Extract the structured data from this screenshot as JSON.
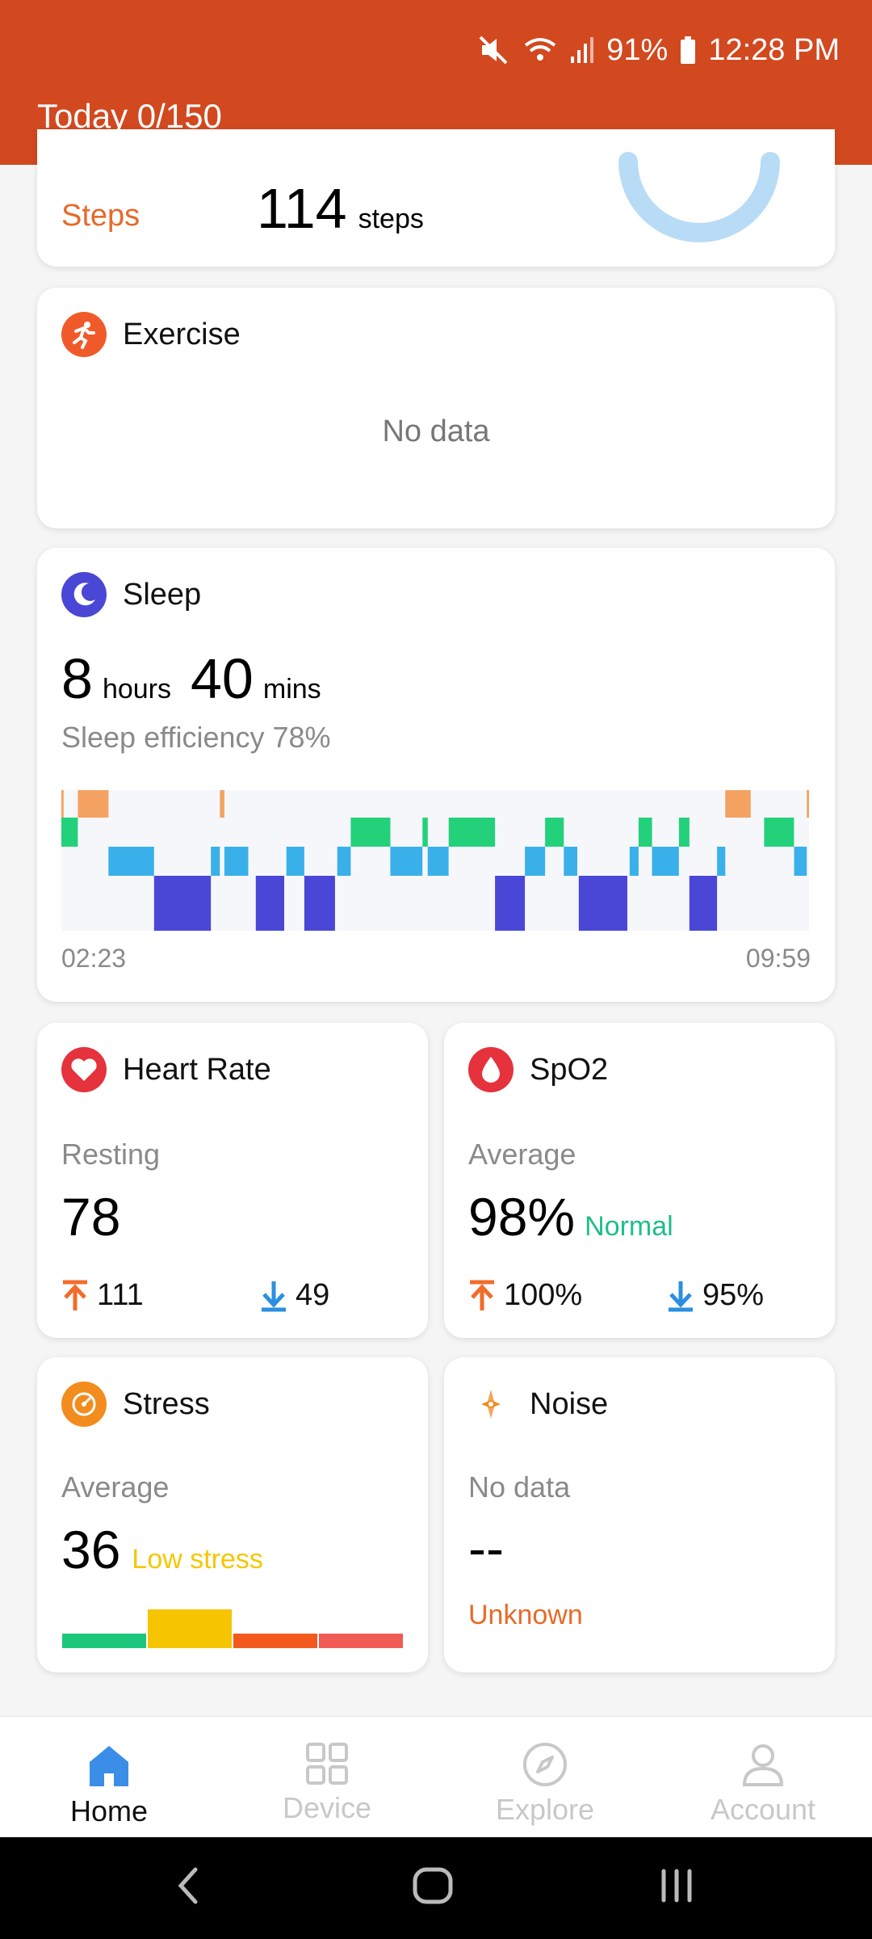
{
  "status_bar": {
    "battery": "91%",
    "time": "12:28 PM"
  },
  "header": {
    "title": "Today 0/150"
  },
  "steps": {
    "label": "Steps",
    "value": "114",
    "unit": "steps"
  },
  "exercise": {
    "title": "Exercise",
    "empty": "No data"
  },
  "sleep": {
    "title": "Sleep",
    "hours": "8",
    "hours_unit": "hours",
    "mins": "40",
    "mins_unit": "mins",
    "efficiency": "Sleep efficiency 78%",
    "start_time": "02:23",
    "end_time": "09:59",
    "stage_colors": {
      "awake": "#f4a261",
      "rem": "#23d17a",
      "light": "#3ab0ea",
      "deep": "#4a47d6"
    },
    "segments": [
      {
        "stage": "awake",
        "start": 0,
        "end": 0.003
      },
      {
        "stage": "awake",
        "start": 0.022,
        "end": 0.063
      },
      {
        "stage": "rem",
        "start": 0,
        "end": 0.022
      },
      {
        "stage": "light",
        "start": 0.063,
        "end": 0.124
      },
      {
        "stage": "deep",
        "start": 0.124,
        "end": 0.2
      },
      {
        "stage": "light",
        "start": 0.2,
        "end": 0.212
      },
      {
        "stage": "awake",
        "start": 0.212,
        "end": 0.218
      },
      {
        "stage": "light",
        "start": 0.218,
        "end": 0.25
      },
      {
        "stage": "deep",
        "start": 0.26,
        "end": 0.298
      },
      {
        "stage": "light",
        "start": 0.301,
        "end": 0.325
      },
      {
        "stage": "deep",
        "start": 0.325,
        "end": 0.366
      },
      {
        "stage": "light",
        "start": 0.369,
        "end": 0.387
      },
      {
        "stage": "rem",
        "start": 0.387,
        "end": 0.44
      },
      {
        "stage": "light",
        "start": 0.44,
        "end": 0.483
      },
      {
        "stage": "rem",
        "start": 0.483,
        "end": 0.49
      },
      {
        "stage": "light",
        "start": 0.49,
        "end": 0.518
      },
      {
        "stage": "rem",
        "start": 0.518,
        "end": 0.58
      },
      {
        "stage": "deep",
        "start": 0.58,
        "end": 0.62
      },
      {
        "stage": "light",
        "start": 0.62,
        "end": 0.647
      },
      {
        "stage": "rem",
        "start": 0.647,
        "end": 0.672
      },
      {
        "stage": "light",
        "start": 0.672,
        "end": 0.69
      },
      {
        "stage": "deep",
        "start": 0.692,
        "end": 0.757
      },
      {
        "stage": "light",
        "start": 0.76,
        "end": 0.772
      },
      {
        "stage": "rem",
        "start": 0.772,
        "end": 0.79
      },
      {
        "stage": "light",
        "start": 0.79,
        "end": 0.826
      },
      {
        "stage": "rem",
        "start": 0.826,
        "end": 0.84
      },
      {
        "stage": "deep",
        "start": 0.84,
        "end": 0.877
      },
      {
        "stage": "light",
        "start": 0.877,
        "end": 0.888
      },
      {
        "stage": "awake",
        "start": 0.888,
        "end": 0.922
      },
      {
        "stage": "rem",
        "start": 0.94,
        "end": 0.98
      },
      {
        "stage": "light",
        "start": 0.98,
        "end": 0.997
      },
      {
        "stage": "awake",
        "start": 0.997,
        "end": 1
      }
    ]
  },
  "heart_rate": {
    "title": "Heart Rate",
    "label": "Resting",
    "value": "78",
    "high": "111",
    "low": "49"
  },
  "spo2": {
    "title": "SpO2",
    "label": "Average",
    "value": "98%",
    "status": "Normal",
    "high": "100%",
    "low": "95%"
  },
  "stress": {
    "title": "Stress",
    "label": "Average",
    "value": "36",
    "status": "Low stress",
    "level_index": 1,
    "bar_colors": [
      "#1cc77c",
      "#f6c400",
      "#f25a1e",
      "#f05b55"
    ]
  },
  "noise": {
    "title": "Noise",
    "label": "No data",
    "value": "--",
    "status": "Unknown"
  },
  "nav": {
    "home": "Home",
    "device": "Device",
    "explore": "Explore",
    "account": "Account"
  },
  "colors": {
    "brand": "#d2481f",
    "up_arrow": "#f26c2a",
    "down_arrow": "#2b8fe0",
    "normal": "#1fbf86",
    "low_stress": "#f5c700",
    "unknown": "#e86a28"
  }
}
